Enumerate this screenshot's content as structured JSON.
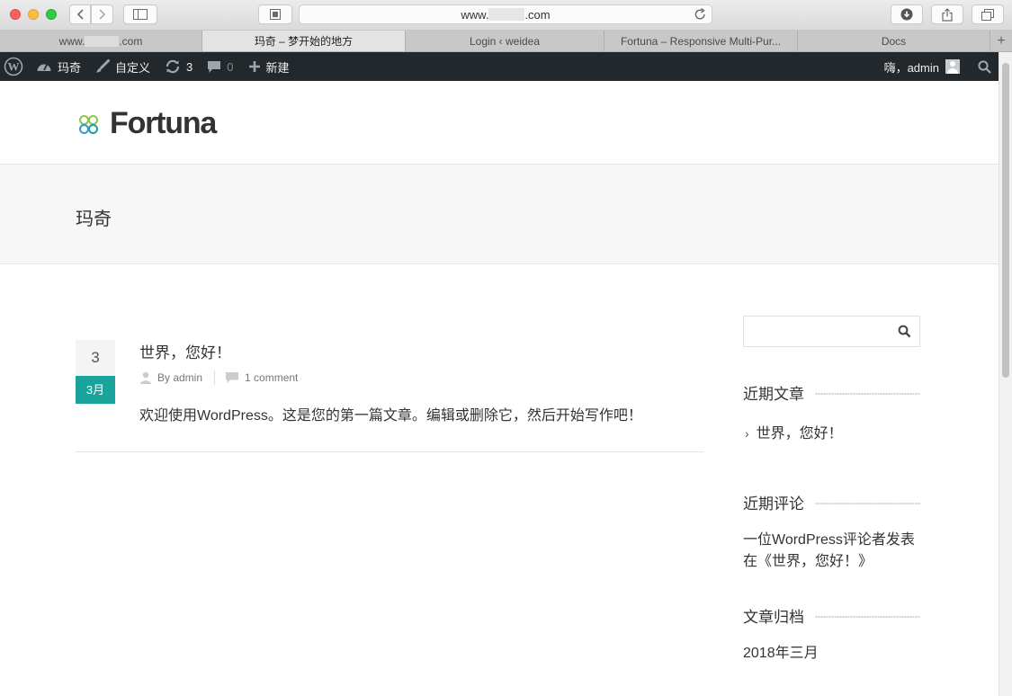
{
  "browser": {
    "url_prefix": "www.",
    "url_suffix": ".com",
    "tabs": [
      {
        "label_prefix": "www.",
        "label_suffix": ".com",
        "active": false
      },
      {
        "label": "玛奇 – 梦开始的地方",
        "active": true
      },
      {
        "label": "Login ‹ weidea",
        "active": false
      },
      {
        "label": "Fortuna – Responsive Multi-Pur...",
        "active": false
      },
      {
        "label": "Docs",
        "active": false
      }
    ],
    "new_tab": "+"
  },
  "adminbar": {
    "site_name": "玛奇",
    "customize": "自定义",
    "updates_count": "3",
    "comments_count": "0",
    "new_label": "新建",
    "greeting": "嗨，admin"
  },
  "site": {
    "logo_text": "Fortuna",
    "page_title": "玛奇",
    "post": {
      "day": "3",
      "month": "3月",
      "title": "世界，您好！",
      "author": "By admin",
      "comments": "1 comment",
      "excerpt": "欢迎使用WordPress。这是您的第一篇文章。编辑或删除它，然后开始写作吧！"
    },
    "sidebar": {
      "search_placeholder": "",
      "recent_posts_title": "近期文章",
      "recent_posts": [
        "世界，您好！"
      ],
      "recent_comments_title": "近期评论",
      "recent_comment_line1": "一位WordPress评论者发表",
      "recent_comment_line2": "在《世界，您好！》",
      "archives_title": "文章归档",
      "archive_item": "2018年三月"
    }
  },
  "colors": {
    "accent": "#1aa39a",
    "adminbar_bg": "#23282d",
    "logo_green": "#8cc63f",
    "logo_teal": "#1aa39a",
    "logo_blue": "#2a9fd6"
  }
}
